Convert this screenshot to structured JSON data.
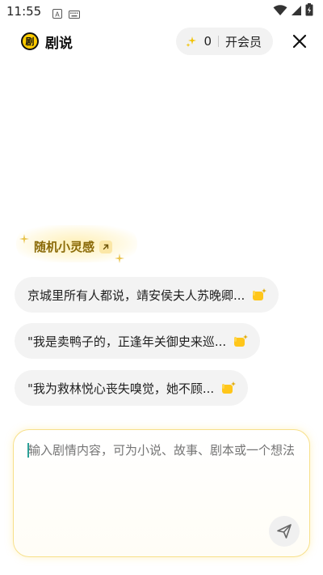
{
  "status_bar": {
    "time": "11:55",
    "icons": [
      "a-notification-icon",
      "keyboard-icon",
      "wifi-icon",
      "signal-icon",
      "battery-charging-icon"
    ]
  },
  "header": {
    "logo_glyph": "剧",
    "title": "剧说",
    "points": "0",
    "vip_label": "开会员",
    "close_icon": "close-icon"
  },
  "inspiration": {
    "label": "随机小灵感",
    "icon": "arrow-up-right-icon"
  },
  "suggestions": [
    {
      "text": "京城里所有人都说，靖安侯夫人苏晚卿...",
      "icon": "clap-hand-icon"
    },
    {
      "text": "\"我是卖鸭子的，正逢年关御史来巡...",
      "icon": "clap-hand-icon"
    },
    {
      "text": "\"我为救林悦心丧失嗅觉，她不顾...",
      "icon": "clap-hand-icon"
    }
  ],
  "composer": {
    "placeholder": "输入剧情内容，可为小说、故事、剧本或一个想法",
    "send_icon": "send-icon"
  },
  "colors": {
    "accent_yellow": "#ffcc00",
    "inspire_text": "#8a6a08",
    "chip_bg": "#f3f3f3"
  }
}
